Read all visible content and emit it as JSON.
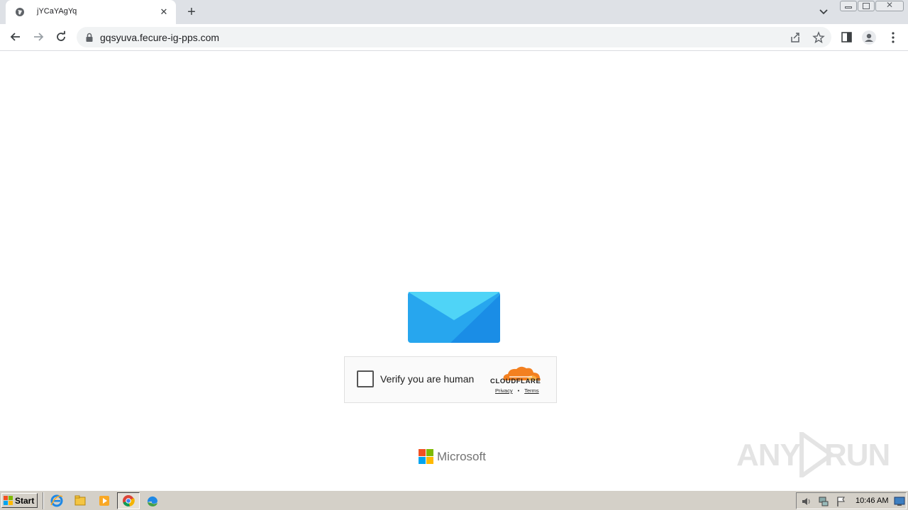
{
  "browser": {
    "tab_title": "jYCaYAgYq",
    "url": "gqsyuva.fecure-ig-pps.com"
  },
  "captcha": {
    "label": "Verify you are human",
    "brand": "CLOUDFLARE",
    "privacy": "Privacy",
    "terms": "Terms"
  },
  "footer": {
    "brand": "Microsoft"
  },
  "watermark": {
    "left": "ANY",
    "right": "RUN"
  },
  "taskbar": {
    "start_label": "Start",
    "clock": "10:46 AM"
  },
  "colors": {
    "envelope_light": "#4fd4f7",
    "envelope_dark": "#1a8de6",
    "cloudflare_orange": "#f38020"
  }
}
